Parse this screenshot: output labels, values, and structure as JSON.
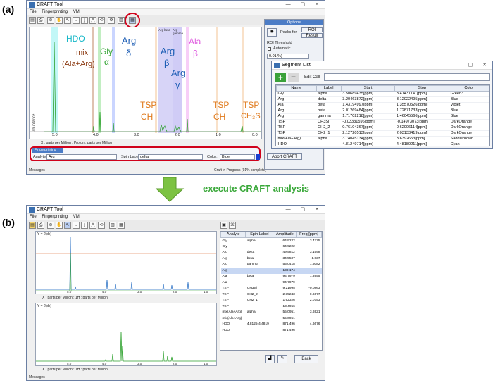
{
  "panel_a": {
    "label": "(a)",
    "title": "CRAFT Tool",
    "menu": [
      "File",
      "Fingerprinting",
      "VM"
    ],
    "annotations": [
      {
        "text": "HDO",
        "color": "#18b8c8"
      },
      {
        "text": "mix",
        "color": "#8b3a12"
      },
      {
        "text": "(Ala+Arg)",
        "color": "#8b3a12"
      },
      {
        "text": "Gly",
        "color": "#2ca02c"
      },
      {
        "text": "α",
        "color": "#2ca02c"
      },
      {
        "text": "Arg",
        "color": "#1f5fb5"
      },
      {
        "text": "δ",
        "color": "#1f5fb5"
      },
      {
        "text": "Arg",
        "color": "#1f5fb5"
      },
      {
        "text": "β",
        "color": "#1f5fb5"
      },
      {
        "text": "Arg",
        "color": "#1f5fb5"
      },
      {
        "text": "γ",
        "color": "#1f5fb5"
      },
      {
        "text": "Ala",
        "color": "#e060e0"
      },
      {
        "text": "β",
        "color": "#e060e0"
      },
      {
        "text": "TSP",
        "color": "#e07a1c"
      },
      {
        "text": "CH",
        "color": "#e07a1c"
      },
      {
        "text": "TSP",
        "color": "#e07a1c"
      },
      {
        "text": "CH",
        "color": "#e07a1c"
      },
      {
        "text": "TSP",
        "color": "#e07a1c"
      },
      {
        "text": "CH₃Si",
        "color": "#e07a1c"
      }
    ],
    "band_labels": [
      "Arg beta",
      "Arg gamma"
    ],
    "xticks": [
      "5.0",
      "4.0",
      "3.0",
      "2.0",
      "1.0",
      "0.0"
    ],
    "axis_label": "abundance",
    "x_axis_text": "X : parts per Million : Proton : parts per Million",
    "fingerprinting": {
      "tab": "Fingerprinting",
      "analyte_label": "Analyte:",
      "analyte_value": "Arg",
      "spin_label": "Spin Label:",
      "spin_value": "delta",
      "color_label": "Color:",
      "color_value": "Blue"
    },
    "messages": "Messages",
    "status": "Craft in Progress (91% complete)",
    "options": {
      "title": "Options",
      "peaks_for": "Peaks for",
      "roi_btn": "ROI",
      "result_btn": "Result",
      "roi_threshold": "ROI Threshold",
      "automatic": "Automatic",
      "threshold_value": "0.01[%]",
      "abort": "Abort CRAFT"
    }
  },
  "segment_list": {
    "title": "Segment List",
    "edit_cell": "Edit Cell",
    "headers": [
      "Name",
      "Label",
      "Start",
      "Stop",
      "Color"
    ],
    "rows": [
      [
        "Gly",
        "alpha",
        "3.50689435[ppm]",
        "3.41431141[ppm]",
        "Green3"
      ],
      [
        "Arg",
        "delta",
        "3.20463872[ppm]",
        "3.12022495[ppm]",
        "Blue"
      ],
      [
        "Ala",
        "beta",
        "1.43194997[ppm]",
        "1.35570526[ppm]",
        "Violet"
      ],
      [
        "Arg",
        "beta",
        "2.01269484[ppm]",
        "1.72871733[ppm]",
        "Blue"
      ],
      [
        "Arg",
        "gamma",
        "1.71702218[ppm]",
        "1.46045566[ppm]",
        "Blue"
      ],
      [
        "TSP",
        "CH3Si",
        "-0.03331596[ppm]",
        "-0.14973073[ppm]",
        "DarkOrange"
      ],
      [
        "TSP",
        "CH2_2",
        "0.76104367[ppm]",
        "0.62006114[ppm]",
        "DarkOrange"
      ],
      [
        "TSP",
        "CH2_1",
        "2.12720513[ppm]",
        "2.03133419[ppm]",
        "DarkOrange"
      ],
      [
        "mix(Ala+Arg)",
        "alpha",
        "3.74045134[ppm]",
        "3.6392653[ppm]",
        "Saddlebrown"
      ],
      [
        "HDO",
        "",
        "4.81249714[ppm]",
        "4.48189211[ppm]",
        "Cyan"
      ]
    ]
  },
  "arrow_label": "execute CRAFT analysis",
  "panel_b": {
    "label": "(b)",
    "title": "CRAFT Tool",
    "menu": [
      "File",
      "Fingerprinting",
      "VM"
    ],
    "plot1_title": "Y = 2[dx]",
    "plot2_title": "Y = 2[dx]",
    "xticks": [
      "5.0",
      "4.0",
      "3.0",
      "2.0",
      "1.0"
    ],
    "x_axis_text": "X : parts per Million : 1H : parts per Million",
    "axis_label": "abundance",
    "messages": "Messages",
    "headers": [
      "Analyte",
      "Spin Label",
      "Amplitude",
      "Freq [ppm]"
    ],
    "rows": [
      [
        "Gly",
        "alpha",
        "64.9222",
        "3.4725"
      ],
      [
        "Gly",
        "",
        "64.9222",
        ""
      ],
      [
        "Arg",
        "delta",
        "49.5812",
        "3.1598"
      ],
      [
        "Arg",
        "beta",
        "34.5507",
        "1.837"
      ],
      [
        "Arg",
        "gamma",
        "55.0418",
        "1.6082"
      ],
      [
        "Arg",
        "",
        "139.174",
        ""
      ],
      [
        "Ala",
        "beta",
        "94.7979",
        "1.3955"
      ],
      [
        "Ala",
        "",
        "94.7979",
        ""
      ],
      [
        "TSP",
        "CH3Si",
        "9.21995",
        "-0.0863"
      ],
      [
        "TSP",
        "CH2_2",
        "2.35243",
        "0.6077"
      ],
      [
        "TSP",
        "CH2_1",
        "1.92326",
        "2.0753"
      ],
      [
        "TSP",
        "",
        "13.4956",
        ""
      ],
      [
        "mix(Ala+Arg)",
        "alpha",
        "55.0951",
        "3.6921"
      ],
      [
        "mix(Ala+Arg)",
        "",
        "55.0951",
        ""
      ],
      [
        "HDO",
        "4.8125-4.4819",
        "871.496",
        "4.6676"
      ],
      [
        "HDO",
        "",
        "871.496",
        ""
      ]
    ],
    "back_btn": "Back"
  }
}
